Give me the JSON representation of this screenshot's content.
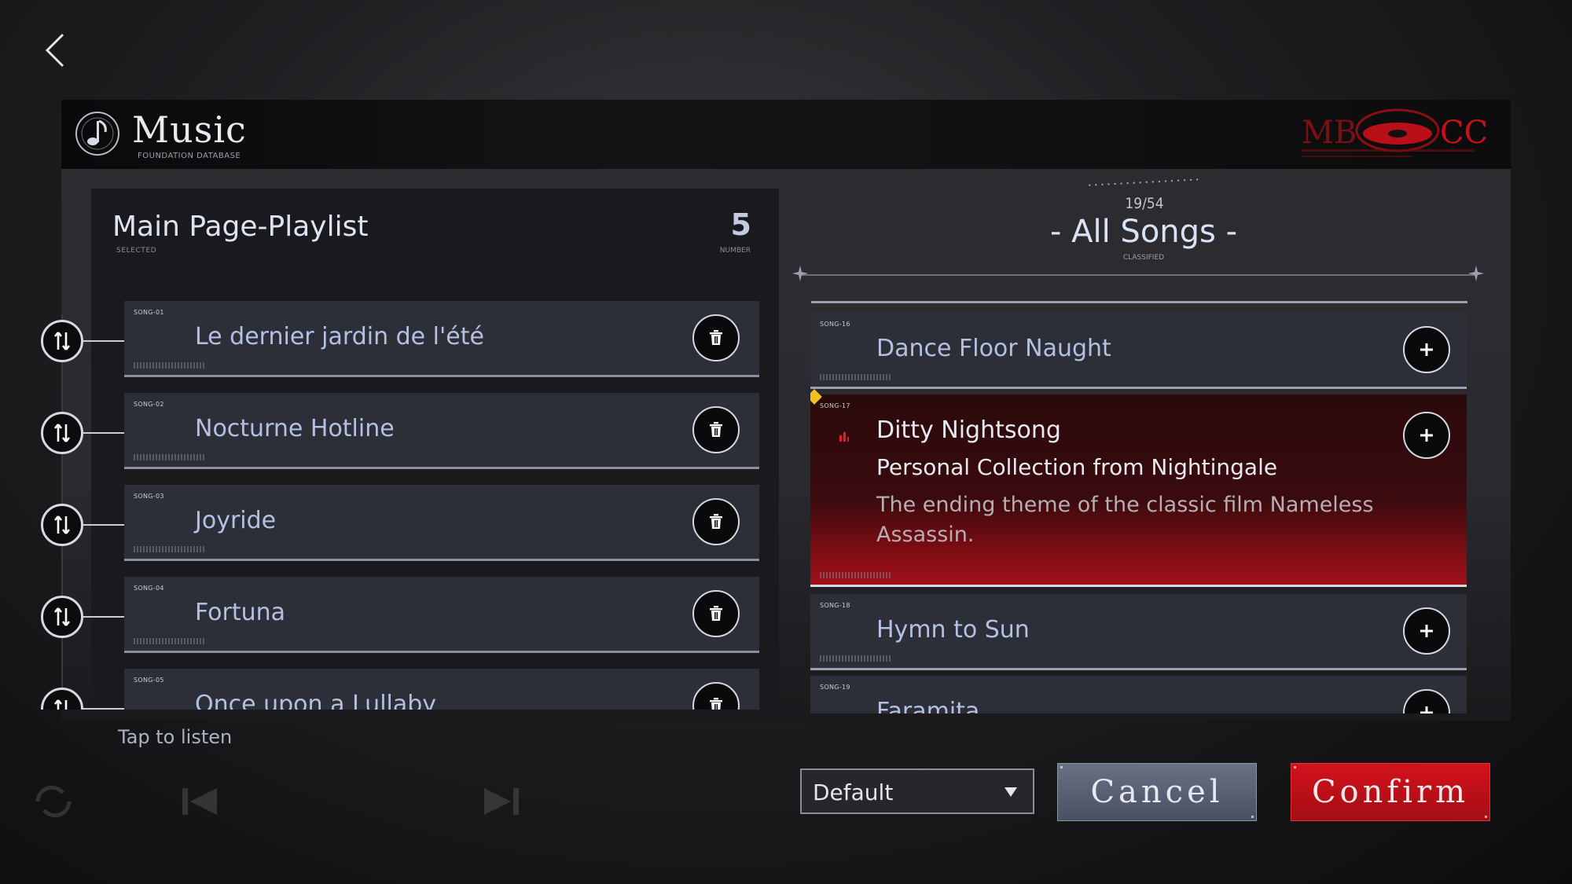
{
  "header": {
    "title": "Music",
    "subtitle": "FOUNDATION DATABASE",
    "brand_logo_text": "MB CC"
  },
  "playlist": {
    "title": "Main Page-Playlist",
    "title_sublabel": "SELECTED",
    "count": "5",
    "count_label": "NUMBER",
    "songs": [
      {
        "code": "SONG-01",
        "title": "Le dernier jardin de l'été"
      },
      {
        "code": "SONG-02",
        "title": "Nocturne Hotline"
      },
      {
        "code": "SONG-03",
        "title": "Joyride"
      },
      {
        "code": "SONG-04",
        "title": "Fortuna"
      },
      {
        "code": "SONG-05",
        "title": "Once upon a Lullaby"
      }
    ],
    "tap_hint": "Tap to listen"
  },
  "library": {
    "counter": "19/54",
    "title": "- All Songs -",
    "title_sublabel": "CLASSIFIED",
    "songs": [
      {
        "code": "SONG-16",
        "title": "Dance Floor Naught"
      },
      {
        "code": "SONG-17",
        "title": "Ditty Nightsong",
        "collection": "Personal Collection from Nightingale",
        "description": "The ending theme of the classic film Nameless Assassin."
      },
      {
        "code": "SONG-18",
        "title": "Hymn to Sun"
      },
      {
        "code": "SONG-19",
        "title": "Faramita"
      }
    ]
  },
  "controls": {
    "sort_value": "Default",
    "cancel_label": "Cancel",
    "confirm_label": "Confirm"
  },
  "colors": {
    "accent_red": "#c8101a",
    "selected_card": "#3a0b0e",
    "card_bg": "#2c2f38",
    "title_blue": "#b3c0e2"
  },
  "icons": {
    "back": "chevron-left-icon",
    "music": "music-note-icon",
    "reorder": "reorder-arrows-icon",
    "delete": "trash-icon",
    "add": "plus-icon",
    "playing": "equalizer-icon",
    "sort": "caret-down-icon"
  }
}
